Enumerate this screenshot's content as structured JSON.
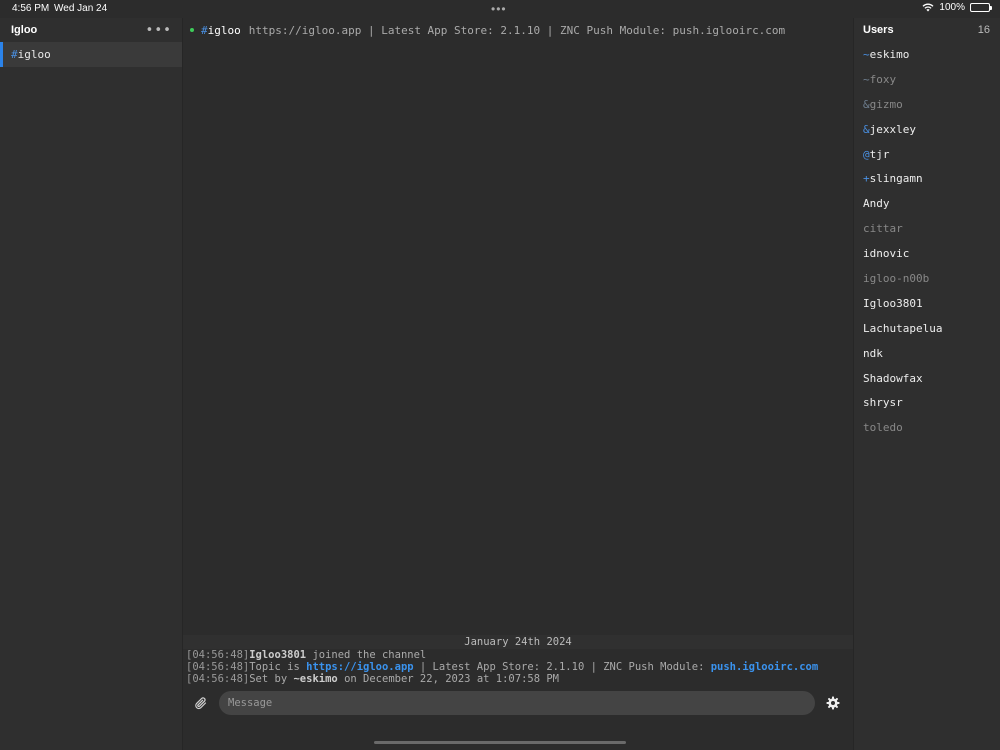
{
  "status_bar": {
    "time": "4:56 PM",
    "date": "Wed Jan 24",
    "battery": "100%"
  },
  "sidebar": {
    "title": "Igloo",
    "more_label": "•••",
    "channels": [
      {
        "prefix": "#",
        "name": "igloo"
      }
    ]
  },
  "main": {
    "channel_prefix": "#",
    "channel_name": "igloo",
    "topic": "https://igloo.app | Latest App Store: 2.1.10 | ZNC Push Module: push.iglooirc.com",
    "date_separator": "January 24th 2024",
    "messages": [
      {
        "ts": "[04:56:48]",
        "nick": "Igloo3801",
        "text": " joined the channel"
      },
      {
        "ts": "[04:56:48]",
        "pre": "Topic is ",
        "link1": "https://igloo.app",
        "mid": " | Latest App Store: 2.1.10 | ZNC Push Module: ",
        "link2": "push.iglooirc.com"
      },
      {
        "ts": "[04:56:48]",
        "pre": "Set by ",
        "nick": "~eskimo",
        "text": " on December 22, 2023 at 1:07:58 PM"
      }
    ],
    "composer_placeholder": "Message"
  },
  "users": {
    "title": "Users",
    "count": "16",
    "list": [
      {
        "prefix": "~",
        "name": "eskimo",
        "away": false
      },
      {
        "prefix": "~",
        "name": "foxy",
        "away": true
      },
      {
        "prefix": "&",
        "name": "gizmo",
        "away": true
      },
      {
        "prefix": "&",
        "name": "jexxley",
        "away": false
      },
      {
        "prefix": "@",
        "name": "tjr",
        "away": false
      },
      {
        "prefix": "+",
        "name": "slingamn",
        "away": false
      },
      {
        "prefix": "",
        "name": "Andy",
        "away": false
      },
      {
        "prefix": "",
        "name": "cittar",
        "away": true
      },
      {
        "prefix": "",
        "name": "idnovic",
        "away": false
      },
      {
        "prefix": "",
        "name": "igloo-n00b",
        "away": true
      },
      {
        "prefix": "",
        "name": "Igloo3801",
        "away": false
      },
      {
        "prefix": "",
        "name": "Lachutapelua",
        "away": false
      },
      {
        "prefix": "",
        "name": "ndk",
        "away": false
      },
      {
        "prefix": "",
        "name": "Shadowfax",
        "away": false
      },
      {
        "prefix": "",
        "name": "shrysr",
        "away": false
      },
      {
        "prefix": "",
        "name": "toledo",
        "away": true
      }
    ]
  },
  "colors": {
    "accent": "#2b83ea",
    "link": "#3a93ef",
    "online": "#3ecb5a",
    "background": "#2c2c2c"
  },
  "icons": {
    "attach": "paperclip-icon",
    "settings": "gear-icon",
    "wifi": "wifi-icon",
    "battery": "battery-icon"
  }
}
